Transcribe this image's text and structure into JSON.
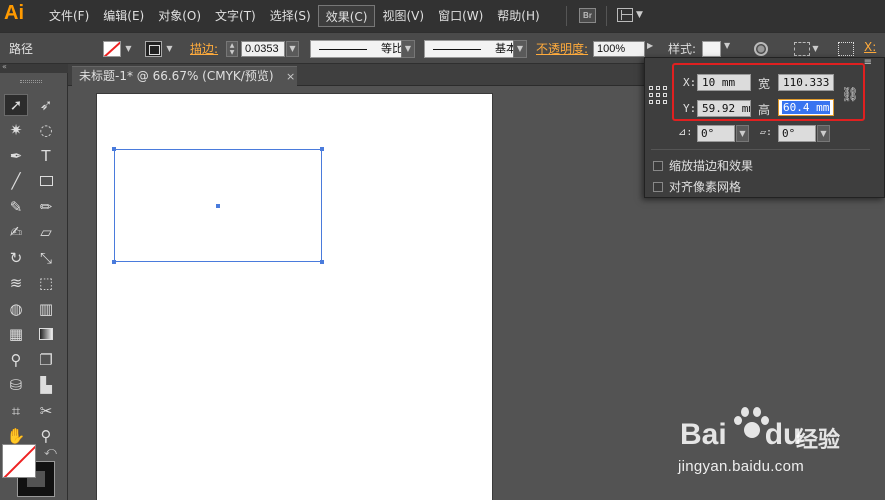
{
  "app": {
    "logo": "Ai"
  },
  "menu": {
    "items": [
      {
        "label": "文件(F)"
      },
      {
        "label": "编辑(E)"
      },
      {
        "label": "对象(O)"
      },
      {
        "label": "文字(T)"
      },
      {
        "label": "选择(S)"
      },
      {
        "label": "效果(C)"
      },
      {
        "label": "视图(V)"
      },
      {
        "label": "窗口(W)"
      },
      {
        "label": "帮助(H)"
      }
    ],
    "active_index": 5,
    "bridge_label": "Br"
  },
  "control_bar": {
    "selection_type": "路径",
    "stroke_label": "描边",
    "stroke_weight": "0.0353",
    "stroke_profile": "等比",
    "brush_profile": "基本",
    "opacity_label": "不透明度",
    "opacity_value": "100%",
    "style_label": "样式",
    "x_label": "X:"
  },
  "document": {
    "tab_title": "未标题-1* @ 66.67% (CMYK/预览)",
    "close_glyph": "×"
  },
  "transform_panel": {
    "menu_glyph": "≡",
    "x_label": "X:",
    "x_value": "10 mm",
    "y_label": "Y:",
    "y_value": "59.92 mm",
    "width_label": "宽",
    "width_value": "110.333",
    "height_label": "高",
    "height_value": "60.4 mm",
    "rotate_value": "0°",
    "shear_value": "0°",
    "scale_strokes_label": "缩放描边和效果",
    "align_pixel_grid_label": "对齐像素网格",
    "highlight_color": "#e02020"
  },
  "colors": {
    "accent": "#ffab3c",
    "selection": "#4a7bdc"
  },
  "watermark": {
    "brand": "Bai",
    "brand_suffix": "du",
    "product": "经验",
    "url": "jingyan.baidu.com"
  }
}
